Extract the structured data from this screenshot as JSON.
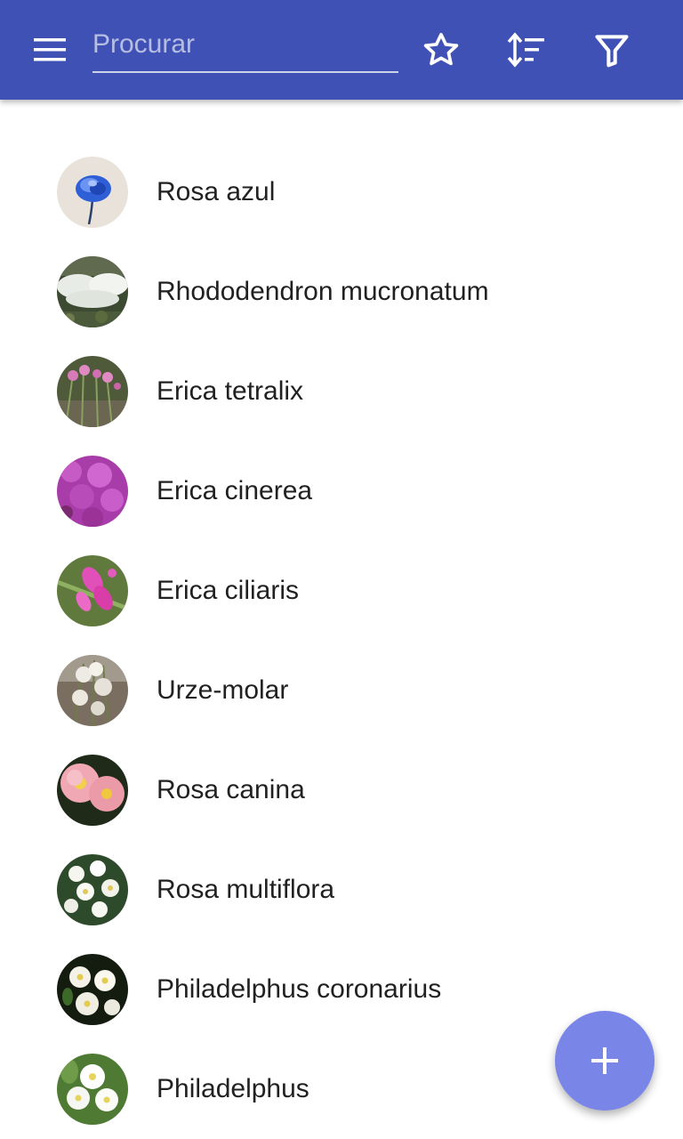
{
  "toolbar": {
    "menu_icon": "menu-icon",
    "search_placeholder": "Procurar",
    "search_value": "",
    "favorite_icon": "star-outline-icon",
    "sort_icon": "sort-icon",
    "filter_icon": "filter-icon",
    "background_color": "#3f51b5"
  },
  "plants": [
    {
      "name": "Rosa azul",
      "thumbnail": "blue-rose-photo"
    },
    {
      "name": "Rhododendron mucronatum",
      "thumbnail": "white-rhododendron-photo"
    },
    {
      "name": "Erica tetralix",
      "thumbnail": "pink-heath-photo"
    },
    {
      "name": "Erica cinerea",
      "thumbnail": "purple-heather-photo"
    },
    {
      "name": "Erica ciliaris",
      "thumbnail": "pink-bell-heath-photo"
    },
    {
      "name": "Urze-molar",
      "thumbnail": "white-heather-photo"
    },
    {
      "name": "Rosa canina",
      "thumbnail": "pink-dog-rose-photo"
    },
    {
      "name": "Rosa multiflora",
      "thumbnail": "white-multiflora-rose-photo"
    },
    {
      "name": "Philadelphus coronarius",
      "thumbnail": "white-mock-orange-photo"
    },
    {
      "name": "Philadelphus",
      "thumbnail": "white-philadelphus-photo"
    }
  ],
  "fab": {
    "icon": "plus-icon",
    "color": "#7986e8"
  }
}
